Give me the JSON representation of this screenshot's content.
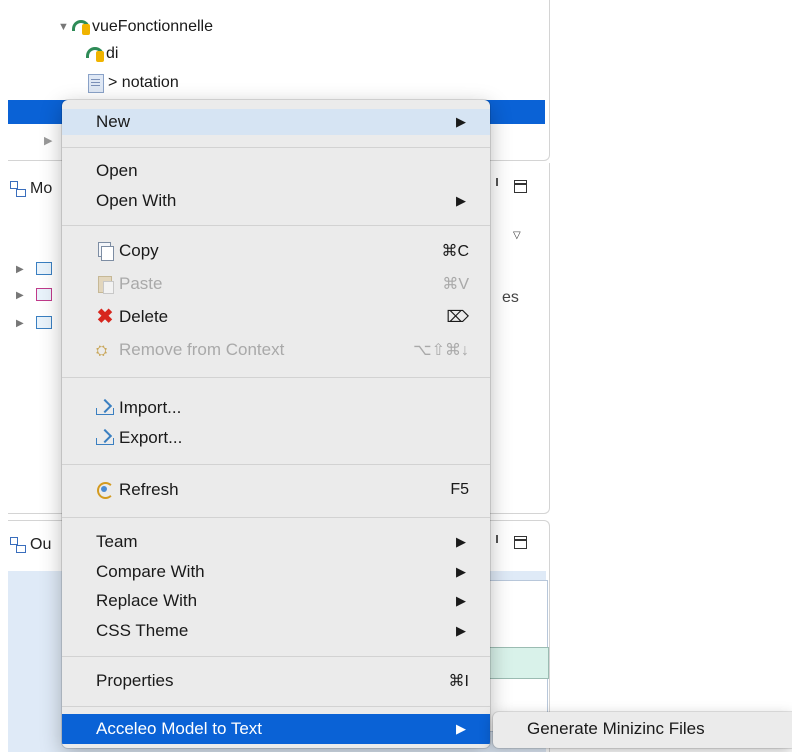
{
  "explorer": {
    "items": [
      {
        "label": "vueFonctionnelle"
      },
      {
        "label": "di"
      },
      {
        "label": "> notation"
      }
    ]
  },
  "model_view": {
    "tab_label": "Mo",
    "stray_text": "es"
  },
  "outline_view": {
    "tab_label": "Ou"
  },
  "context_menu": {
    "new": {
      "label": "New"
    },
    "open": {
      "label": "Open"
    },
    "open_with": {
      "label": "Open With"
    },
    "copy": {
      "label": "Copy",
      "shortcut": "⌘C"
    },
    "paste": {
      "label": "Paste",
      "shortcut": "⌘V"
    },
    "delete": {
      "label": "Delete",
      "shortcut": "⌦"
    },
    "remove_from_context": {
      "label": "Remove from Context",
      "shortcut": "⌥⇧⌘↓"
    },
    "import": {
      "label": "Import..."
    },
    "export": {
      "label": "Export..."
    },
    "refresh": {
      "label": "Refresh",
      "shortcut": "F5"
    },
    "team": {
      "label": "Team"
    },
    "compare_with": {
      "label": "Compare With"
    },
    "replace_with": {
      "label": "Replace With"
    },
    "css_theme": {
      "label": "CSS Theme"
    },
    "properties": {
      "label": "Properties",
      "shortcut": "⌘I"
    },
    "acceleo": {
      "label": "Acceleo Model to Text"
    }
  },
  "submenu": {
    "generate": {
      "label": "Generate Minizinc Files"
    }
  },
  "colors": {
    "selection": "#0a62d6",
    "menu_bg": "#ebebeb",
    "hover_light": "#d6e4f3"
  },
  "icons": {
    "submenu_arrow": "▶",
    "tree_expand": "▼",
    "tree_collapsed": "▶"
  }
}
